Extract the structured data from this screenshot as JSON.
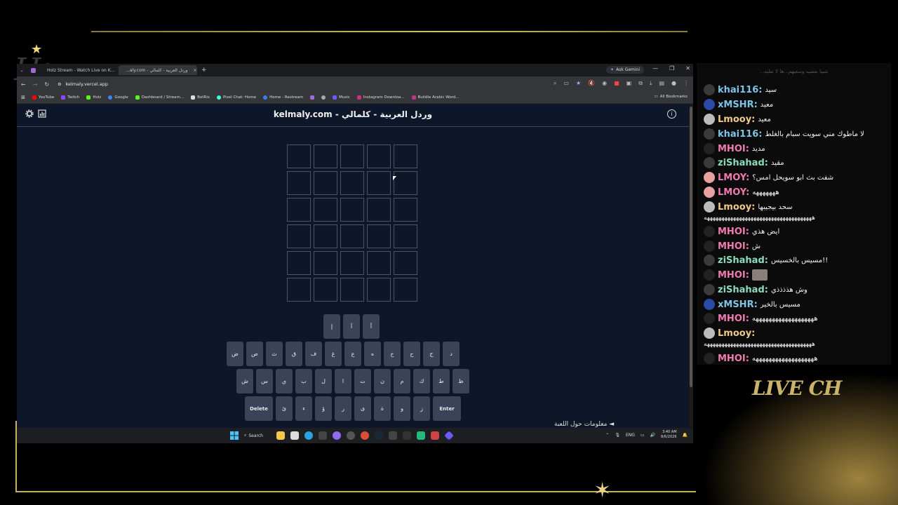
{
  "browser": {
    "tabs": [
      {
        "label": "",
        "color": "#a06ad8",
        "active": false
      },
      {
        "label": "Holz Stream - Watch Live on K...",
        "color": "#53fc18",
        "active": false
      },
      {
        "label": "...aly.com - وردل العربية - كلمالي",
        "color": "#5a9",
        "active": true
      }
    ],
    "gemini_label": "Ask Gemini",
    "url": "kelmaly.vercel.app",
    "bookmarks": [
      {
        "label": "YouTube",
        "color": "#ff0000"
      },
      {
        "label": "Twitch",
        "color": "#9146ff"
      },
      {
        "label": "Holz",
        "color": "#53fc18"
      },
      {
        "label": "Google",
        "color": "#4285f4"
      },
      {
        "label": "Dashboard / Stream...",
        "color": "#53fc18"
      },
      {
        "label": "BotRix",
        "color": "#dddddd"
      },
      {
        "label": "Pixel Chat: Home",
        "color": "#4fd"
      },
      {
        "label": "Home - Restream",
        "color": "#3b7bff"
      },
      {
        "label": "",
        "color": "#a06ad8"
      },
      {
        "label": "",
        "color": "#aaaaaa"
      },
      {
        "label": "Music",
        "color": "#6b5bff"
      },
      {
        "label": "Instagram Downloa...",
        "color": "#c13584"
      },
      {
        "label": "Buildle Arabic Word...",
        "color": "#c13584"
      }
    ],
    "all_bookmarks": "All Bookmarks"
  },
  "page": {
    "title": "kelmaly.com - وردل العربية - كلمالي",
    "keyboard": {
      "row1": [
        "إ",
        "آ",
        "أ"
      ],
      "row2": [
        "ض",
        "ص",
        "ث",
        "ق",
        "ف",
        "غ",
        "ع",
        "ه",
        "خ",
        "ح",
        "ج",
        "د"
      ],
      "row3": [
        "ش",
        "س",
        "ي",
        "ب",
        "ل",
        "ا",
        "ت",
        "ن",
        "م",
        "ك",
        "ط",
        "ظ"
      ],
      "row4": [
        "Delete",
        "ئ",
        "ء",
        "ؤ",
        "ر",
        "ى",
        "ة",
        "و",
        "ز",
        "Enter"
      ]
    },
    "bottom_link": "معلومات حول اللعبة ◄"
  },
  "taskbar": {
    "search": "Search",
    "lang": "ENG",
    "time": "3:40 AM",
    "date": "8/6/2026"
  },
  "chat": {
    "top_faded": "...شيبا بعضيه وسعيهم...ها لا تعليه",
    "messages": [
      {
        "name": "khai116:",
        "text": "سيد",
        "color": "#7ec4e8"
      },
      {
        "name": "xMSHR:",
        "text": "معيد",
        "color": "#7ec4e8"
      },
      {
        "name": "Lmooy:",
        "text": "معيد",
        "color": "#f0c88a"
      },
      {
        "name": "khai116:",
        "text": "لا ماطوك مني سويت سبام بالغلط",
        "color": "#7ec4e8"
      },
      {
        "name": "MHOI:",
        "text": "مديد",
        "color": "#f07ab2"
      },
      {
        "name": "ziShahad:",
        "text": "مقيد",
        "color": "#8adcbc"
      },
      {
        "name": "LMOY:",
        "text": "شفت بث ابو سويحل امس؟",
        "color": "#f07ab2"
      },
      {
        "name": "LMOY:",
        "text": "هههههههه",
        "color": "#f07ab2"
      },
      {
        "name": "Lmooy:",
        "text": "سحد بيجيبها",
        "color": "#f0c88a"
      },
      {
        "name": "MHOI:",
        "text": "ايض هذي",
        "color": "#f07ab2"
      },
      {
        "name": "MHOI:",
        "text": "ش",
        "color": "#f07ab2"
      },
      {
        "name": "ziShahad:",
        "text": "مسيس بالخسيس!!",
        "color": "#8adcbc"
      },
      {
        "name": "MHOI:",
        "text": "",
        "color": "#f07ab2"
      },
      {
        "name": "ziShahad:",
        "text": "وش هذذذذي",
        "color": "#8adcbc"
      },
      {
        "name": "xMSHR:",
        "text": "مسيس بالخير",
        "color": "#7ec4e8"
      },
      {
        "name": "MHOI:",
        "text": "هههههههههههههههههههه",
        "color": "#f07ab2"
      },
      {
        "name": "Lmooy:",
        "text": "",
        "color": "#f0c88a"
      },
      {
        "name": "MHOI:",
        "text": "هههههههههههههههههههه",
        "color": "#f07ab2"
      }
    ],
    "long_laugh_1": "هههههههههههههههههههههههههههههههههههههه",
    "long_laugh_2": "هههههههههههههههههههههههههههههههههههههه"
  },
  "overlay": {
    "live_chat": "LIVE CH",
    "logo": "Hz"
  }
}
